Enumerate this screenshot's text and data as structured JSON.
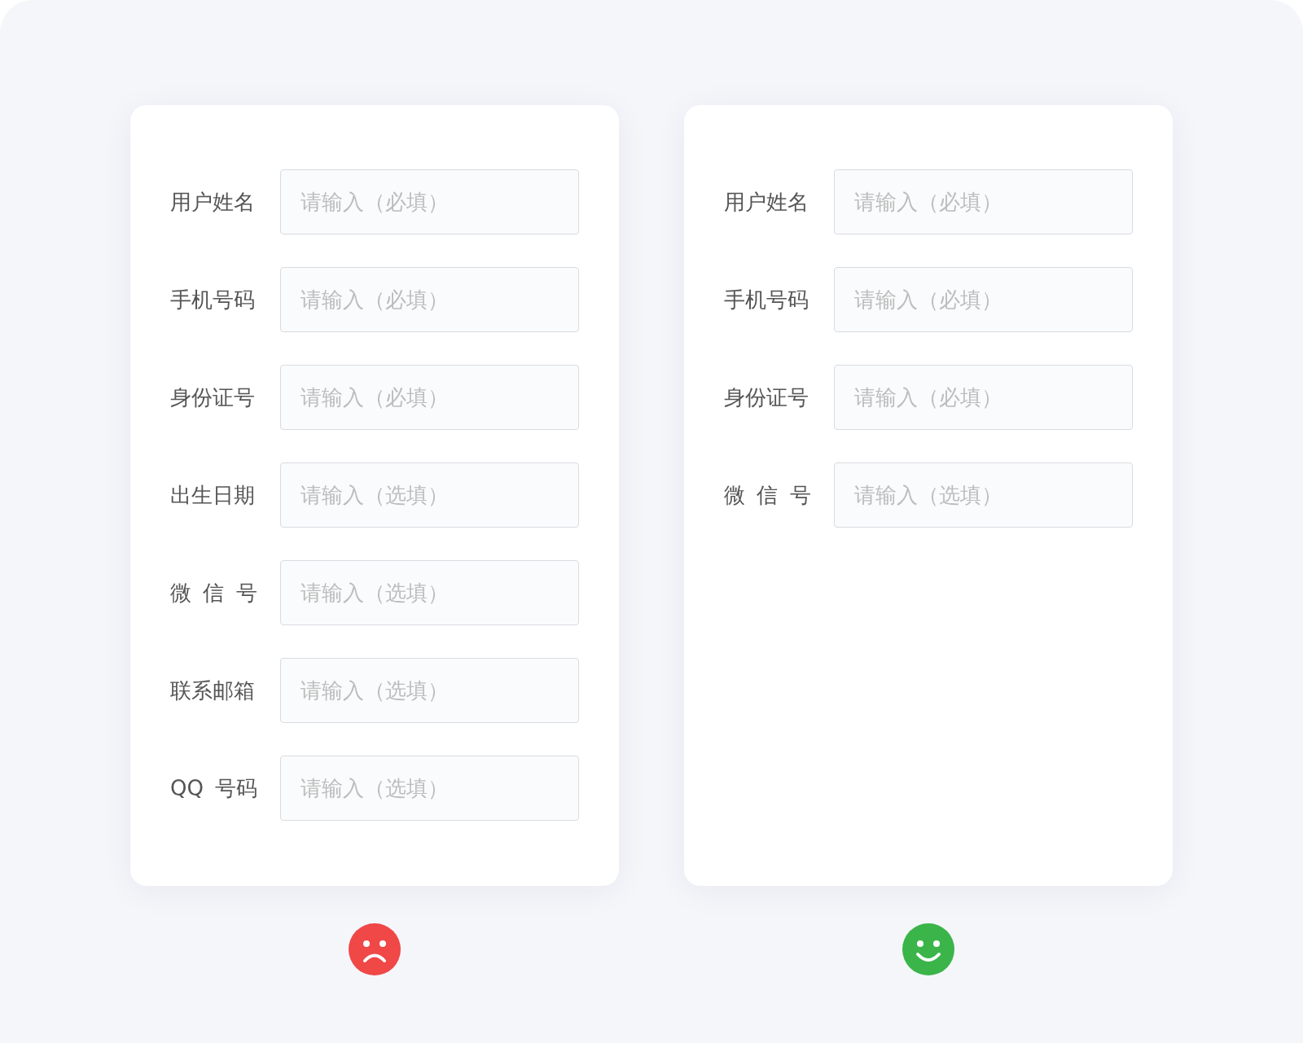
{
  "panels": [
    {
      "kind": "sad",
      "color": "#f04747",
      "fields": [
        {
          "label": "用户姓名",
          "placeholder": "请输入（必填）"
        },
        {
          "label": "手机号码",
          "placeholder": "请输入（必填）"
        },
        {
          "label": "身份证号",
          "placeholder": "请输入（必填）"
        },
        {
          "label": "出生日期",
          "placeholder": "请输入（选填）"
        },
        {
          "label": "微 信 号",
          "placeholder": "请输入（选填）"
        },
        {
          "label": "联系邮箱",
          "placeholder": "请输入（选填）"
        },
        {
          "label": "QQ 号码",
          "placeholder": "请输入（选填）"
        }
      ]
    },
    {
      "kind": "happy",
      "color": "#3bb54a",
      "fields": [
        {
          "label": "用户姓名",
          "placeholder": "请输入（必填）"
        },
        {
          "label": "手机号码",
          "placeholder": "请输入（必填）"
        },
        {
          "label": "身份证号",
          "placeholder": "请输入（必填）"
        },
        {
          "label": "微 信 号",
          "placeholder": "请输入（选填）"
        }
      ]
    }
  ]
}
